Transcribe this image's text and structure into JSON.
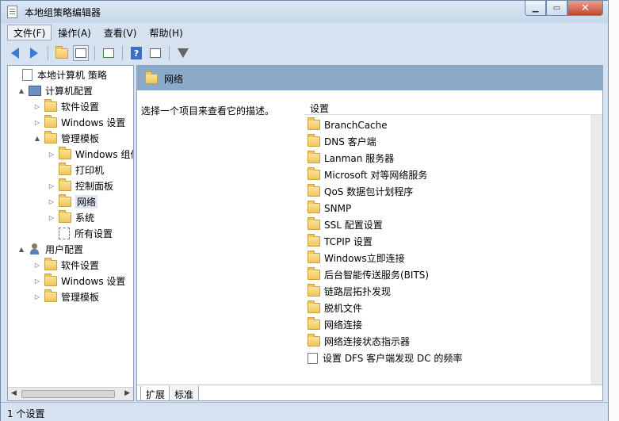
{
  "window": {
    "title": "本地组策略编辑器"
  },
  "menu": [
    "文件(F)",
    "操作(A)",
    "查看(V)",
    "帮助(H)"
  ],
  "tree": [
    {
      "label": "本地计算机 策略",
      "icon": "document-icon",
      "expander": ""
    },
    {
      "label": "计算机配置",
      "icon": "computer-icon",
      "expander": "▲"
    },
    {
      "label": "软件设置",
      "icon": "folder-icon",
      "expander": "▷"
    },
    {
      "label": "Windows 设置",
      "icon": "folder-icon",
      "expander": "▷"
    },
    {
      "label": "管理模板",
      "icon": "folder-icon",
      "expander": "▲"
    },
    {
      "label": "Windows 组件",
      "icon": "folder-icon",
      "expander": "▷"
    },
    {
      "label": "打印机",
      "icon": "folder-icon",
      "expander": ""
    },
    {
      "label": "控制面板",
      "icon": "folder-icon",
      "expander": "▷"
    },
    {
      "label": "网络",
      "icon": "folder-icon",
      "expander": "▷",
      "selected": true
    },
    {
      "label": "系统",
      "icon": "folder-icon",
      "expander": "▷"
    },
    {
      "label": "所有设置",
      "icon": "all-settings-icon",
      "expander": ""
    },
    {
      "label": "用户配置",
      "icon": "user-icon",
      "expander": "▲"
    },
    {
      "label": "软件设置",
      "icon": "folder-icon",
      "expander": "▷"
    },
    {
      "label": "Windows 设置",
      "icon": "folder-icon",
      "expander": "▷"
    },
    {
      "label": "管理模板",
      "icon": "folder-icon",
      "expander": "▷"
    }
  ],
  "right": {
    "header_title": "网络",
    "description": "选择一个项目来查看它的描述。",
    "column_header": "设置",
    "items": [
      {
        "label": "BranchCache",
        "type": "folder"
      },
      {
        "label": "DNS 客户端",
        "type": "folder"
      },
      {
        "label": "Lanman 服务器",
        "type": "folder"
      },
      {
        "label": "Microsoft 对等网络服务",
        "type": "folder"
      },
      {
        "label": "QoS 数据包计划程序",
        "type": "folder"
      },
      {
        "label": "SNMP",
        "type": "folder"
      },
      {
        "label": "SSL 配置设置",
        "type": "folder"
      },
      {
        "label": "TCPIP 设置",
        "type": "folder"
      },
      {
        "label": "Windows立即连接",
        "type": "folder"
      },
      {
        "label": "后台智能传送服务(BITS)",
        "type": "folder"
      },
      {
        "label": "链路层拓扑发现",
        "type": "folder"
      },
      {
        "label": "脱机文件",
        "type": "folder"
      },
      {
        "label": "网络连接",
        "type": "folder"
      },
      {
        "label": "网络连接状态指示器",
        "type": "folder"
      },
      {
        "label": "设置 DFS 客户端发现 DC 的频率",
        "type": "setting"
      }
    ],
    "tabs": [
      "扩展",
      "标准"
    ]
  },
  "status": "1 个设置"
}
